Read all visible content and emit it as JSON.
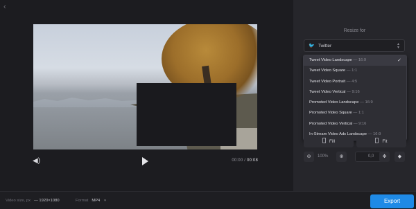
{
  "player": {
    "back_icon": "chevron-left-icon",
    "volume_icon": "volume-icon",
    "play_icon": "play-icon",
    "time_current": "00:00",
    "time_separator": "/",
    "time_total": "00:08"
  },
  "sidebar": {
    "title": "Resize for",
    "platform": {
      "icon": "twitter-icon",
      "label": "Twitter"
    },
    "presets": [
      {
        "label": "Tweet Video Landscape",
        "ratio": "— 16:9",
        "selected": true
      },
      {
        "label": "Tweet Video Square",
        "ratio": "— 1:1"
      },
      {
        "label": "Tweet Video Portrait",
        "ratio": "— 4:5"
      },
      {
        "label": "Tweet Video Vertical",
        "ratio": "— 9:16"
      },
      {
        "label": "Promoted Video Landscape",
        "ratio": "— 16:9"
      },
      {
        "label": "Promoted Video Square",
        "ratio": "— 1:1"
      },
      {
        "label": "Promoted Video Vertical",
        "ratio": "— 9:16"
      },
      {
        "label": "In-Stream Video Ads Landscape",
        "ratio": "— 16:9"
      }
    ],
    "fill_label": "Fill",
    "fit_label": "Fit",
    "zoom_value": "100%",
    "rotate_value": "0,0"
  },
  "footer": {
    "video_size_label": "Video size, px",
    "video_size_value": "— 1920×1080",
    "format_label": "Format",
    "format_value": "MP4",
    "export_label": "Export"
  },
  "colors": {
    "accent": "#1f8ae6",
    "background": "#1c1c20",
    "panel": "#26262b"
  }
}
